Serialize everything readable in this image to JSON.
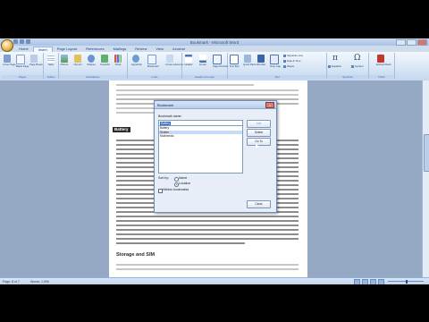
{
  "window": {
    "title": "Bookmark - Microsoft Word"
  },
  "tabs": [
    "Home",
    "Insert",
    "Page Layout",
    "References",
    "Mailings",
    "Review",
    "View",
    "Acrobat"
  ],
  "ribbon": {
    "groups": {
      "pages": "Pages",
      "tables": "Tables",
      "illustrations": "Illustrations",
      "links": "Links",
      "header_footer": "Header & Footer",
      "text": "Text",
      "symbols": "Symbols",
      "flash": "Flash"
    },
    "buttons": {
      "cover_page": "Cover Page",
      "blank_page": "Blank Page",
      "page_break": "Page Break",
      "table": "Table",
      "picture": "Picture",
      "clip_art": "Clip Art",
      "shapes": "Shapes",
      "smartart": "SmartArt",
      "chart": "Chart",
      "hyperlink": "Hyperlink",
      "bookmark": "Bookmark",
      "cross_reference": "Cross-reference",
      "header": "Header",
      "footer": "Footer",
      "page_number": "Page Number",
      "text_box": "Text Box",
      "quick_parts": "Quick Parts",
      "wordart": "WordArt",
      "drop_cap": "Drop Cap",
      "signature_line": "Signature Line",
      "date_time": "Date & Time",
      "object": "Object",
      "equation": "Equation",
      "symbol": "Symbol",
      "embed_flash": "Embed Flash"
    }
  },
  "document": {
    "heading": "Battery",
    "heading2": "Storage and SIM"
  },
  "dialog": {
    "title": "Bookmark",
    "name_label": "Bookmark name:",
    "name_value": "Battery",
    "list_items": [
      "Battery",
      "Screen",
      "Multimedia"
    ],
    "selected_index": 1,
    "sort_label": "Sort by:",
    "sort_name": "Name",
    "sort_location": "Location",
    "sort_selected": "Location",
    "hidden_label": "Hidden bookmarks",
    "hidden_checked": false,
    "buttons": {
      "add": "Add",
      "delete": "Delete",
      "go_to": "Go To",
      "close": "Close"
    }
  },
  "status": {
    "page": "Page: 8 of 7",
    "words": "Words: 1,506"
  },
  "colors": {
    "ribbon": "#d6e4f5",
    "accent": "#15428b",
    "selection": "#316ac5"
  }
}
